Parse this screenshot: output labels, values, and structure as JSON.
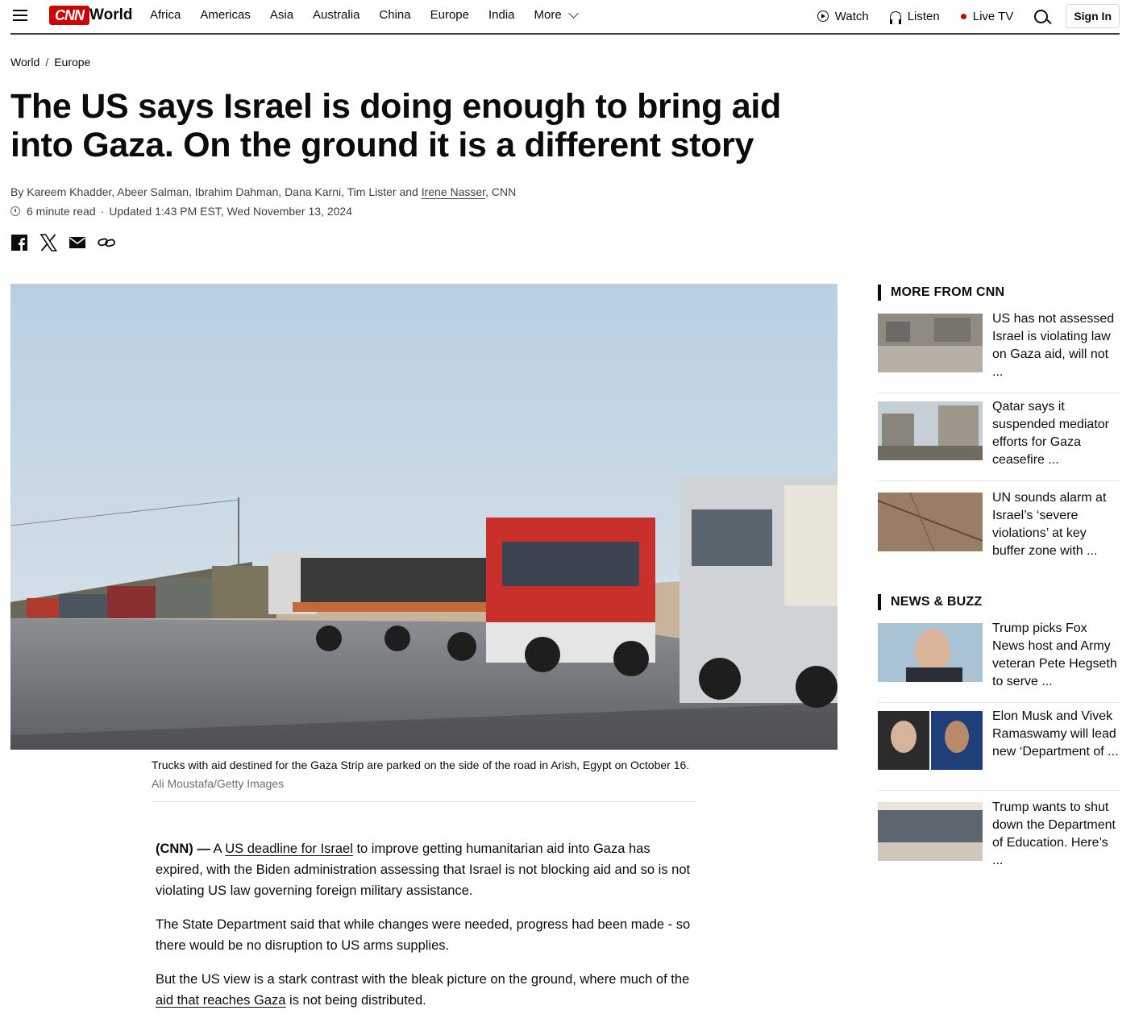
{
  "header": {
    "logo": "CNN",
    "section": "World",
    "nav": [
      "Africa",
      "Americas",
      "Asia",
      "Australia",
      "China",
      "Europe",
      "India"
    ],
    "more": "More",
    "watch": "Watch",
    "listen": "Listen",
    "live_tv": "Live TV",
    "sign_in": "Sign In"
  },
  "breadcrumb": [
    "World",
    "Europe"
  ],
  "article": {
    "headline": "The US says Israel is doing enough to bring aid into Gaza. On the ground it is a different story",
    "byline_prefix": "By Kareem Khadder, Abeer Salman, Ibrahim Dahman, Dana Karni, Tim Lister and ",
    "byline_link": "Irene Nasser",
    "byline_suffix": ", CNN",
    "read_time": "6 minute read",
    "updated": "Updated 1:43 PM EST, Wed November 13, 2024",
    "caption": "Trucks with aid destined for the Gaza Strip are parked on the side of the road in Arish, Egypt on October 16.",
    "credit": "Ali Moustafa/Getty Images",
    "p1_lead": "(CNN) —",
    "p1_a": " A ",
    "p1_link": "US deadline for Israel",
    "p1_b": " to improve getting humanitarian aid into Gaza has expired, with the Biden administration assessing that Israel is not blocking aid and so is not violating US law governing foreign military assistance.",
    "p2": "The State Department said that while changes were needed, progress had been made - so there would be no disruption to US arms supplies.",
    "p3_a": "But the US view is a stark contrast with the bleak picture on the ground, where much of the ",
    "p3_link": "aid that reaches Gaza",
    "p3_b": " is not being distributed."
  },
  "sidebar": {
    "more_heading": "MORE FROM CNN",
    "more": [
      {
        "title": "US has not assessed Israel is violating law on Gaza aid, will not ..."
      },
      {
        "title": "Qatar says it suspended mediator efforts for Gaza ceasefire ..."
      },
      {
        "title": "UN sounds alarm at Israel’s ‘severe violations’ at key buffer zone with ..."
      }
    ],
    "buzz_heading": "NEWS & BUZZ",
    "buzz": [
      {
        "title": "Trump picks Fox News host and Army veteran Pete Hegseth to serve ..."
      },
      {
        "title": "Elon Musk and Vivek Ramaswamy will lead new ‘Department of ..."
      },
      {
        "title": "Trump wants to shut down the Department of Education. Here’s ..."
      }
    ]
  },
  "colors": {
    "brand": "#cc0000",
    "text": "#0c0c0c",
    "muted": "#6e6e6e"
  }
}
